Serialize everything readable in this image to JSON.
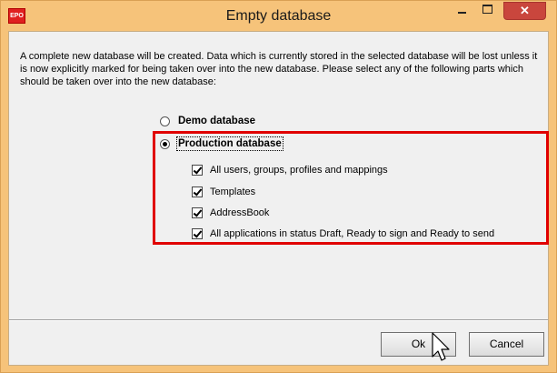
{
  "window": {
    "title": "Empty database",
    "app_icon_label": "EPO",
    "close_glyph": "✕"
  },
  "dialog": {
    "intro_text": "A complete new database will be created. Data which is currently stored in the selected database will be lost unless it is now explicitly marked for being taken over into the new database. Please select any of the following parts which should be taken over into the new database:",
    "options": [
      {
        "label": "Demo database",
        "selected": false
      },
      {
        "label": "Production database",
        "selected": true
      }
    ],
    "checkboxes": [
      {
        "label": "All users, groups, profiles and mappings",
        "checked": true
      },
      {
        "label": "Templates",
        "checked": true
      },
      {
        "label": "AddressBook",
        "checked": true
      },
      {
        "label": "All applications in status Draft, Ready to sign and Ready to send",
        "checked": true
      }
    ],
    "ok_label": "Ok",
    "cancel_label": "Cancel"
  },
  "colors": {
    "titlebar": "#f6c37a",
    "close_button": "#c9463d",
    "highlight": "#e00000"
  }
}
